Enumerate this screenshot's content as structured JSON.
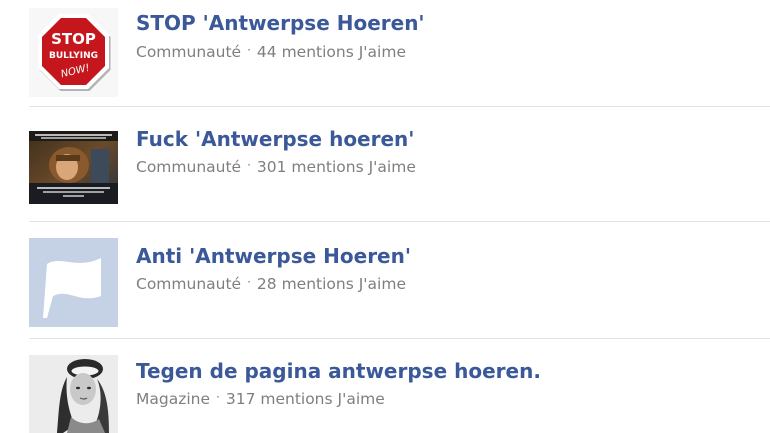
{
  "results": [
    {
      "title": "STOP 'Antwerpse Hoeren'",
      "category": "Communauté",
      "separator": "·",
      "likes": "44 mentions J'aime",
      "thumbnail": {
        "icon": "stop-bullying-sign-icon",
        "sign_lines": [
          "STOP",
          "BULLYING",
          "NOW!"
        ],
        "color": "#c4161c"
      }
    },
    {
      "title": "Fuck 'Antwerpse hoeren'",
      "category": "Communauté",
      "separator": "·",
      "likes": "301 mentions J'aime",
      "thumbnail": {
        "icon": "meme-photo-thumbnail"
      }
    },
    {
      "title": "Anti 'Antwerpse Hoeren'",
      "category": "Communauté",
      "separator": "·",
      "likes": "28 mentions J'aime",
      "thumbnail": {
        "icon": "flag-placeholder-icon",
        "color": "#c5d2e6"
      }
    },
    {
      "title": "Tegen de pagina antwerpse hoeren.",
      "category": "Magazine",
      "separator": "·",
      "likes": "317 mentions J'aime",
      "thumbnail": {
        "icon": "portrait-photo-thumbnail"
      }
    }
  ],
  "colors": {
    "link": "#3b5998",
    "meta": "#7f7f7f",
    "divider": "#e3e3e3"
  }
}
